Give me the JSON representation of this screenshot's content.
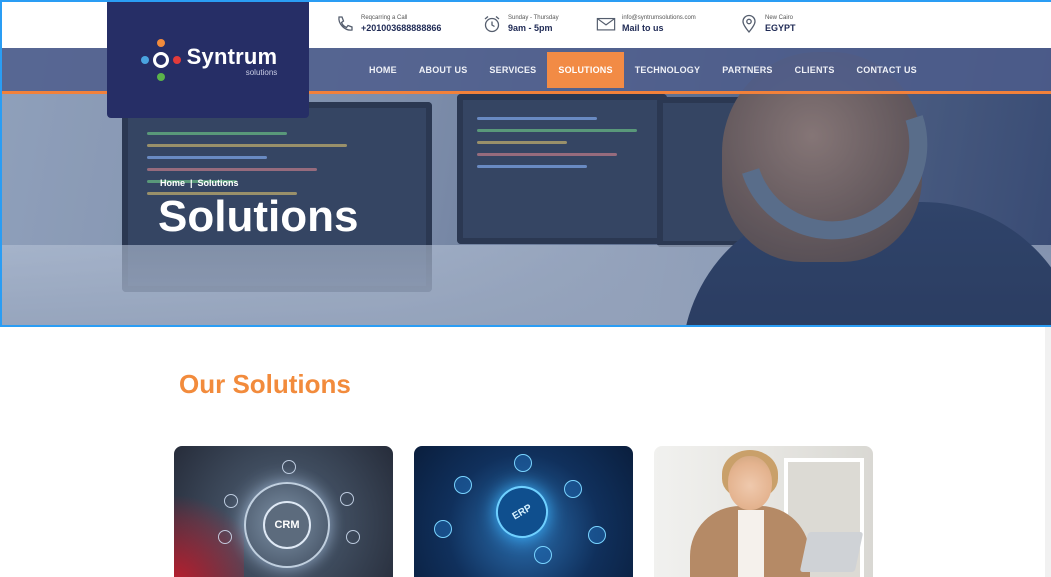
{
  "topbar": {
    "call": {
      "icon": "phone-icon",
      "label": "Reqcarring a Call",
      "value": "+201003688888866"
    },
    "hours": {
      "icon": "alarm-clock-icon",
      "label": "Sunday - Thursday",
      "value": "9am - 5pm"
    },
    "mail": {
      "icon": "envelope-icon",
      "label": "info@syntrumsolutions.com",
      "value": "Mail to us"
    },
    "location": {
      "icon": "map-pin-icon",
      "label": "New Cairo",
      "value": "EGYPT"
    }
  },
  "logo": {
    "name": "Syntrum",
    "tagline": "solutions"
  },
  "nav": {
    "items": [
      {
        "label": "HOME",
        "active": false
      },
      {
        "label": "ABOUT US",
        "active": false
      },
      {
        "label": "SERVICES",
        "active": false
      },
      {
        "label": "SOLUTIONS",
        "active": true
      },
      {
        "label": "TECHNOLOGY",
        "active": false
      },
      {
        "label": "PARTNERS",
        "active": false
      },
      {
        "label": "CLIENTS",
        "active": false
      },
      {
        "label": "CONTACT US",
        "active": false
      }
    ]
  },
  "hero": {
    "breadcrumb": {
      "home": "Home",
      "separator": "|",
      "current": "Solutions"
    },
    "title": "Solutions"
  },
  "solutions": {
    "heading": "Our Solutions",
    "cards": [
      {
        "image": "crm-image",
        "badge": "CRM"
      },
      {
        "image": "erp-image",
        "badge": "ERP"
      },
      {
        "image": "business-woman-image",
        "badge": ""
      }
    ]
  },
  "colors": {
    "accent": "#f28b3c",
    "brand_navy": "#262e66",
    "nav_bg": "#4e5d8c",
    "active_tab": "#f28b45"
  }
}
